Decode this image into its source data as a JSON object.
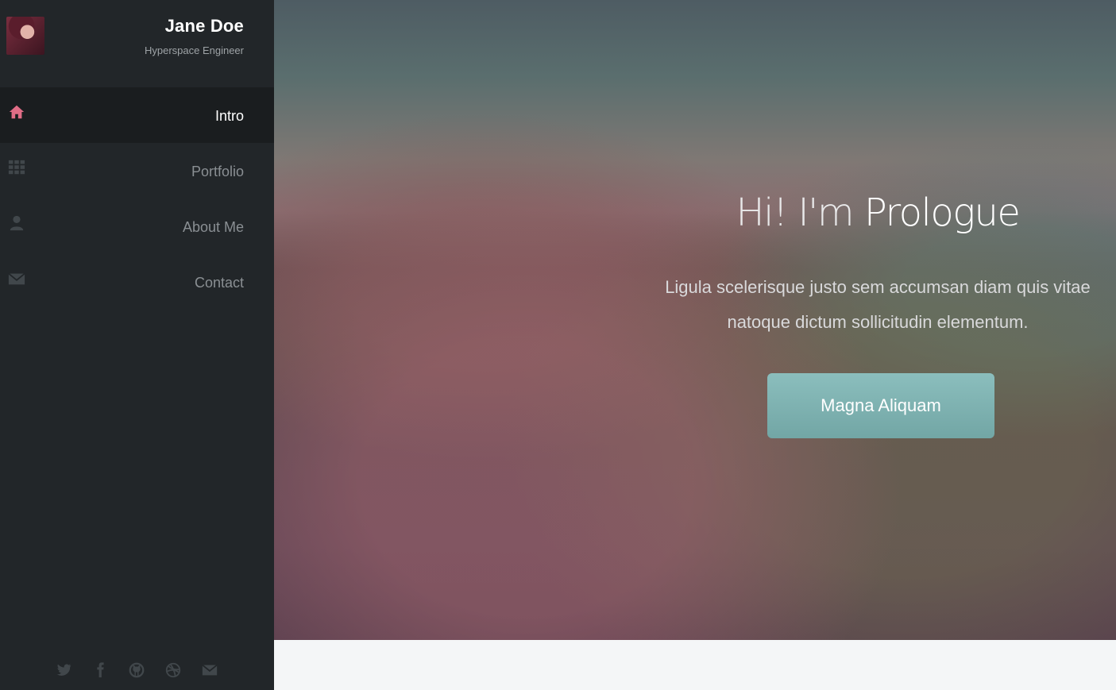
{
  "profile": {
    "name": "Jane Doe",
    "role": "Hyperspace Engineer"
  },
  "nav": {
    "items": [
      {
        "label": "Intro",
        "icon": "home-icon",
        "active": true
      },
      {
        "label": "Portfolio",
        "icon": "grid-icon",
        "active": false
      },
      {
        "label": "About Me",
        "icon": "user-icon",
        "active": false
      },
      {
        "label": "Contact",
        "icon": "envelope-icon",
        "active": false
      }
    ]
  },
  "social": [
    "twitter-icon",
    "facebook-icon",
    "github-icon",
    "dribbble-icon",
    "envelope-icon"
  ],
  "hero": {
    "title_plain": "Hi! I'm ",
    "title_strong": "Prologue",
    "text": "Ligula scelerisque justo sem accumsan diam quis vitae natoque dictum sollicitudin elementum.",
    "button_label": "Magna Aliquam"
  },
  "colors": {
    "sidebar_bg": "#222629",
    "active_bg": "#1a1d1f",
    "accent": "#e06d86",
    "button": "#7fb2b1"
  }
}
